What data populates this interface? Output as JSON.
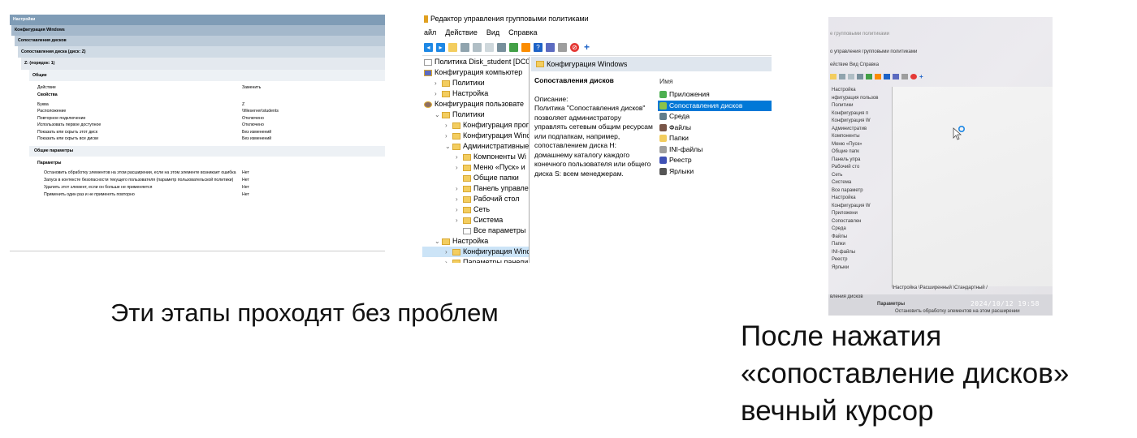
{
  "report": {
    "h1": "Настройки",
    "h2": "Конфигурация Windows",
    "h3": "Сопоставления дисков",
    "h4": "Сопоставления диска (диск: Z)",
    "h5": "Z: (порядок: 1)",
    "h6": "Общие",
    "col_action": "Действие",
    "col_action_val": "Заменить",
    "props_title": "Свойства",
    "props": [
      {
        "k": "Буква",
        "v": "Z"
      },
      {
        "k": "Расположение",
        "v": "\\\\fileserver\\students"
      },
      {
        "k": "Повторное подключение",
        "v": "Отключено"
      },
      {
        "k": "Использовать первое доступное",
        "v": "Отключено"
      },
      {
        "k": "Показать или скрыть этот диск",
        "v": "Без изменений"
      },
      {
        "k": "Показать или скрыть все диски",
        "v": "Без изменений"
      }
    ],
    "common_title": "Общие параметры",
    "params_title": "Параметры",
    "params": [
      {
        "k": "Остановить обработку элементов на этом расширении, если на этом элементе возникает ошибка",
        "v": "Нет"
      },
      {
        "k": "Запуск в контексте безопасности текущего пользователя (параметр пользовательской политики)",
        "v": "Нет"
      },
      {
        "k": "Удалить этот элемент, если он больше не применяется",
        "v": "Нет"
      },
      {
        "k": "Применить один раз и не применять повторно",
        "v": "Нет"
      }
    ]
  },
  "gpo": {
    "title": "Редактор управления групповыми политиками",
    "menu": [
      "айл",
      "Действие",
      "Вид",
      "Справка"
    ],
    "tree": [
      {
        "t": "Политика Disk_student [DC05.C",
        "lvl": 0,
        "chev": "",
        "kind": "doc"
      },
      {
        "t": "Конфигурация компьютер",
        "lvl": 0,
        "chev": "",
        "kind": "pc"
      },
      {
        "t": "Политики",
        "lvl": 1,
        "chev": ">",
        "kind": "folder"
      },
      {
        "t": "Настройка",
        "lvl": 1,
        "chev": ">",
        "kind": "folder"
      },
      {
        "t": "Конфигурация пользовате",
        "lvl": 0,
        "chev": "",
        "kind": "user"
      },
      {
        "t": "Политики",
        "lvl": 1,
        "chev": "v",
        "kind": "folder"
      },
      {
        "t": "Конфигурация прог",
        "lvl": 2,
        "chev": ">",
        "kind": "folder"
      },
      {
        "t": "Конфигурация Winc",
        "lvl": 2,
        "chev": ">",
        "kind": "folder"
      },
      {
        "t": "Административные",
        "lvl": 2,
        "chev": "v",
        "kind": "folder"
      },
      {
        "t": "Компоненты Wi",
        "lvl": 3,
        "chev": ">",
        "kind": "folder"
      },
      {
        "t": "Меню «Пуск» и",
        "lvl": 3,
        "chev": ">",
        "kind": "folder"
      },
      {
        "t": "Общие папки",
        "lvl": 3,
        "chev": "",
        "kind": "folder"
      },
      {
        "t": "Панель управле",
        "lvl": 3,
        "chev": ">",
        "kind": "folder"
      },
      {
        "t": "Рабочий стол",
        "lvl": 3,
        "chev": ">",
        "kind": "folder"
      },
      {
        "t": "Сеть",
        "lvl": 3,
        "chev": ">",
        "kind": "folder"
      },
      {
        "t": "Система",
        "lvl": 3,
        "chev": ">",
        "kind": "folder"
      },
      {
        "t": "Все параметры",
        "lvl": 3,
        "chev": "",
        "kind": "doc"
      },
      {
        "t": "Настройка",
        "lvl": 1,
        "chev": "v",
        "kind": "folder"
      },
      {
        "t": "Конфигурация Winc",
        "lvl": 2,
        "chev": ">",
        "kind": "folder",
        "sel": true
      },
      {
        "t": "Параметры панели",
        "lvl": 2,
        "chev": ">",
        "kind": "folder"
      }
    ],
    "right_header": "Конфигурация Windows",
    "desc_title": "Сопоставления дисков",
    "desc_label": "Описание:",
    "desc_text": "Политика \"Сопоставления дисков\" позволяет администратору управлять сетевым общим ресурсам или подпапкам, например, сопоставлением диска H: домашнему каталогу каждого конечного пользователя или общего диска S: всем менеджерам.",
    "col_name": "Имя",
    "items": [
      {
        "t": "Приложения",
        "c": "#4caf50"
      },
      {
        "t": "Сопоставления дисков",
        "c": "#8bc34a",
        "sel": true
      },
      {
        "t": "Среда",
        "c": "#607d8b"
      },
      {
        "t": "Файлы",
        "c": "#795548"
      },
      {
        "t": "Папки",
        "c": "#f3cd5f"
      },
      {
        "t": "INI-файлы",
        "c": "#9e9e9e"
      },
      {
        "t": "Реестр",
        "c": "#3f51b5"
      },
      {
        "t": "Ярлыки",
        "c": "#555555"
      }
    ]
  },
  "photo": {
    "line1": "е групповыми политиками",
    "line2": "о управления групповыми политиками",
    "menu": "ействие  Вид  Справка",
    "tree": [
      "Настройка",
      "нфигурация пользов",
      "Политики",
      "Конфигурация п",
      "Конфигурация W",
      "Административ",
      "Компоненты",
      "Меню «Пуск»",
      "Общие папк",
      "Панель упра",
      "Рабочий сто",
      "Сеть",
      "Система",
      "Все параметр",
      "Настройка",
      "Конфигурация W",
      "Приложени",
      "Сопоставлен",
      "Среда",
      "Файлы",
      "Папки",
      "INI-файлы",
      "Реестр",
      "Ярлыки"
    ],
    "tabs": "\\Настройка \\Расширенный \\Стандартный /",
    "bottom1": "вления дисков",
    "bottom2": "Параметры",
    "bottom3": "Остановить обработку элементов на этом расширении",
    "timestamp": "2024/10/12 19:58"
  },
  "captions": {
    "left": "Эти этапы проходят без проблем",
    "right_l1": "После нажатия",
    "right_l2": "«сопоставление дисков»",
    "right_l3": "вечный курсор"
  }
}
